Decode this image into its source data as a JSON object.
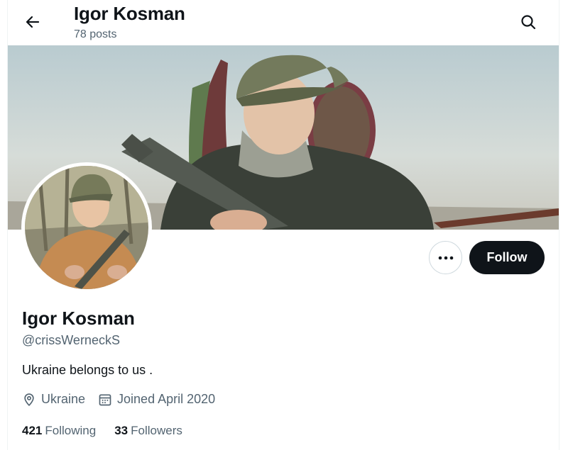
{
  "header": {
    "title": "Igor Kosman",
    "posts_count": "78 posts",
    "back_icon": "arrow-left-icon",
    "search_icon": "search-icon"
  },
  "profile": {
    "display_name": "Igor Kosman",
    "handle": "@crissWerneckS",
    "bio": "Ukraine belongs to us .",
    "location": "Ukraine",
    "joined": "Joined April 2020",
    "following_count": "421",
    "following_label": "Following",
    "followers_count": "33",
    "followers_label": "Followers"
  },
  "actions": {
    "more_icon": "more-horizontal-icon",
    "follow_label": "Follow"
  },
  "colors": {
    "text_primary": "#0f1419",
    "text_secondary": "#536471",
    "border": "#cfd9de",
    "follow_bg": "#0f1419"
  }
}
